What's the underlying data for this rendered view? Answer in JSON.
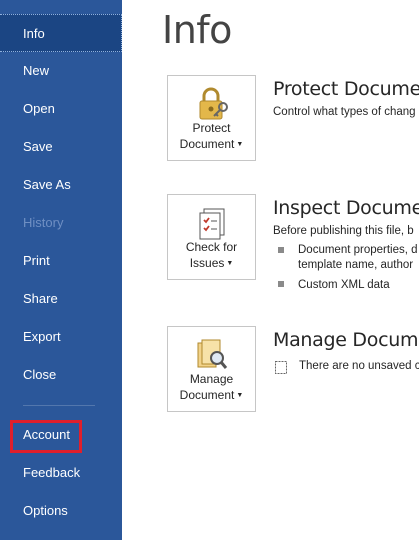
{
  "sidebar": {
    "items": [
      {
        "label": "Info"
      },
      {
        "label": "New"
      },
      {
        "label": "Open"
      },
      {
        "label": "Save"
      },
      {
        "label": "Save As"
      },
      {
        "label": "History"
      },
      {
        "label": "Print"
      },
      {
        "label": "Share"
      },
      {
        "label": "Export"
      },
      {
        "label": "Close"
      }
    ],
    "bottom_items": [
      {
        "label": "Account"
      },
      {
        "label": "Feedback"
      },
      {
        "label": "Options"
      }
    ]
  },
  "main": {
    "title": "Info",
    "sections": [
      {
        "tile_line1": "Protect",
        "tile_line2": "Document",
        "title": "Protect Document",
        "description": "Control what types of chang"
      },
      {
        "tile_line1": "Check for",
        "tile_line2": "Issues",
        "title": "Inspect Document",
        "description": "Before publishing this file, b",
        "bullets": [
          {
            "line1": "Document properties, d",
            "line2": "template name, author"
          },
          {
            "line1": "Custom XML data"
          }
        ]
      },
      {
        "tile_line1": "Manage",
        "tile_line2": "Document",
        "title": "Manage Document",
        "description": "There are no unsaved c"
      }
    ]
  },
  "colors": {
    "sidebar_bg": "#2b579a",
    "active_bg": "#1b4583",
    "highlight": "#e01f2b"
  }
}
